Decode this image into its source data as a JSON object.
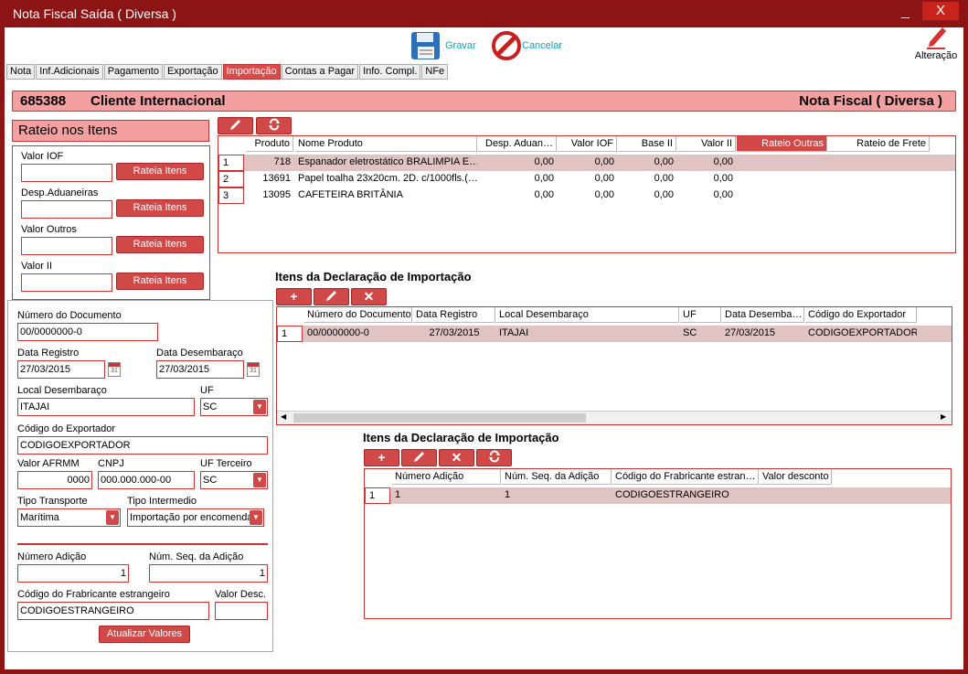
{
  "window": {
    "title": "Nota Fiscal Saída ( Diversa )",
    "minimize": "_",
    "close": "X"
  },
  "toolbar": {
    "save": "Gravar",
    "cancel": "Cancelar",
    "alter": "Alteração"
  },
  "tabs": [
    "Nota",
    "Inf.Adicionais",
    "Pagamento",
    "Exportação",
    "Importação",
    "Contas a Pagar",
    "Info. Compl.",
    "NFe"
  ],
  "header": {
    "number": "685388",
    "client": "Cliente Internacional",
    "type": "Nota Fiscal ( Diversa )"
  },
  "rateio": {
    "title": "Rateio nos Itens",
    "fields": [
      {
        "label": "Valor IOF",
        "value": ""
      },
      {
        "label": "Desp.Aduaneiras",
        "value": ""
      },
      {
        "label": "Valor Outros",
        "value": ""
      },
      {
        "label": "Valor II",
        "value": ""
      }
    ],
    "button": "Rateia Itens"
  },
  "form": {
    "num_doc_label": "Número do Documento",
    "num_doc": "00/0000000-0",
    "data_reg_label": "Data Registro",
    "data_reg": "27/03/2015",
    "data_des_label": "Data Desembaraço",
    "data_des": "27/03/2015",
    "local_label": "Local Desembaraço",
    "local": "ITAJAI",
    "uf_label": "UF",
    "uf": "SC",
    "cod_exp_label": "Código do Exportador",
    "cod_exp": "CODIGOEXPORTADOR",
    "afrmm_label": "Valor AFRMM",
    "afrmm": "0000",
    "cnpj_label": "CNPJ",
    "cnpj": "000.000.000-00",
    "uf_terc_label": "UF Terceiro",
    "uf_terc": "SC",
    "transp_label": "Tipo Transporte",
    "transp": "Marítima",
    "interm_label": "Tipo Intermedio",
    "interm": "Importação por encomenda",
    "num_adic_label": "Número Adição",
    "num_adic": "1",
    "seq_label": "Núm. Seq. da Adição",
    "seq": "1",
    "fab_label": "Código do Frabricante estrangeiro",
    "fab": "CODIGOESTRANGEIRO",
    "desc_label": "Valor Desc.",
    "desc": "",
    "update_button": "Atualizar Valores"
  },
  "items_grid": {
    "headers": [
      "Produto",
      "Nome Produto",
      "Desp. Aduan…",
      "Valor IOF",
      "Base II",
      "Valor II",
      "Rateio Outras",
      "Rateio de Frete"
    ],
    "rows": [
      {
        "n": "1",
        "produto": "718",
        "nome": "Espanador eletrostático BRALIMPIA E…",
        "desp": "0,00",
        "iof": "0,00",
        "base": "0,00",
        "vii": "0,00"
      },
      {
        "n": "2",
        "produto": "13691",
        "nome": "Papel toalha 23x20cm. 2D. c/1000fls.(…",
        "desp": "0,00",
        "iof": "0,00",
        "base": "0,00",
        "vii": "0,00"
      },
      {
        "n": "3",
        "produto": "13095",
        "nome": "CAFETEIRA BRITÂNIA",
        "desp": "0,00",
        "iof": "0,00",
        "base": "0,00",
        "vii": "0,00"
      }
    ]
  },
  "di_section": {
    "title": "Itens da Declaração de Importação",
    "headers": [
      "Número do Documento",
      "Data Registro",
      "Local Desembaraço",
      "UF",
      "Data Desemba…",
      "Código do Exportador"
    ],
    "rows": [
      {
        "n": "1",
        "doc": "00/0000000-0",
        "data": "27/03/2015",
        "local": "ITAJAI",
        "uf": "SC",
        "des": "27/03/2015",
        "exp": "CODIGOEXPORTADOR"
      }
    ]
  },
  "adicao_section": {
    "title": "Itens da Declaração de Importação",
    "headers": [
      "Número Adição",
      "Núm. Seq. da Adição",
      "Código do Frabricante estran…",
      "Valor desconto"
    ],
    "rows": [
      {
        "n": "1",
        "num": "1",
        "seq": "1",
        "fab": "CODIGOESTRANGEIRO"
      }
    ]
  },
  "colors": {
    "frame": "#8c1414",
    "accent": "#d04848",
    "header_bg": "#f4a0a0",
    "selected_row": "#e0c4c4"
  }
}
